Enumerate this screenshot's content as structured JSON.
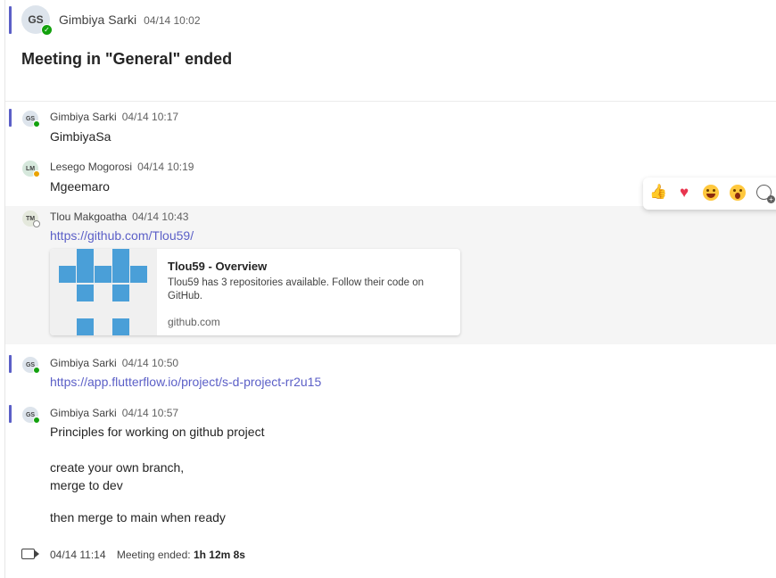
{
  "header_post": {
    "avatar_initials": "GS",
    "author": "Gimbiya Sarki",
    "time": "04/14 10:02",
    "title": "Meeting in \"General\" ended"
  },
  "messages": [
    {
      "initials": "GS",
      "author": "Gimbiya Sarki",
      "time": "04/14 10:17",
      "text": "GimbiyaSa",
      "presence": "available"
    },
    {
      "initials": "LM",
      "author": "Lesego Mogorosi",
      "time": "04/14 10:19",
      "text": "Mgeemaro",
      "presence": "away"
    },
    {
      "initials": "TM",
      "author": "Tlou Makgoatha",
      "time": "04/14 10:43",
      "link": "https://github.com/Tlou59/",
      "presence": "offline"
    },
    {
      "initials": "GS",
      "author": "Gimbiya Sarki",
      "time": "04/14 10:50",
      "link": "https://app.flutterflow.io/project/s-d-project-rr2u15",
      "presence": "available"
    },
    {
      "initials": "GS",
      "author": "Gimbiya Sarki",
      "time": "04/14 10:57",
      "lines": [
        "Principles for working on github project",
        "create your own branch,",
        "merge to dev",
        "then merge to main when ready"
      ],
      "presence": "available"
    }
  ],
  "link_preview": {
    "title": "Tlou59 - Overview",
    "description": "Tlou59 has 3 repositories available. Follow their code on GitHub.",
    "domain": "github.com"
  },
  "reactions": [
    "like-icon",
    "heart-icon",
    "laugh-icon",
    "surprised-icon",
    "add-reaction-icon"
  ],
  "meeting_footer": {
    "time": "04/14 11:14",
    "label": "Meeting ended:",
    "duration": "1h 12m 8s"
  },
  "colors": {
    "accent": "#5b5fc7",
    "link": "#5b5fc7",
    "available": "#13a10e",
    "away": "#eaa300"
  }
}
